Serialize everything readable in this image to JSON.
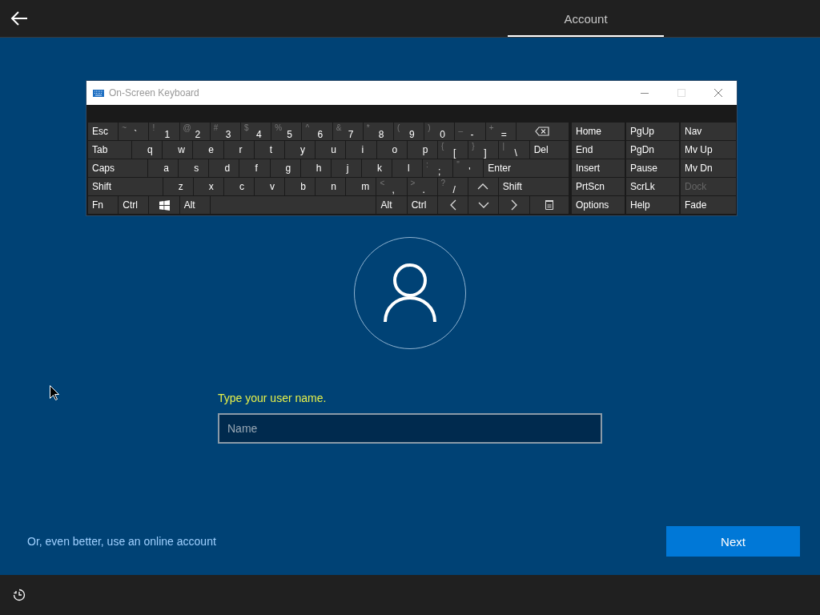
{
  "top_bar": {
    "tabs": [
      {
        "label": "Account",
        "selected": true
      }
    ]
  },
  "keyboard": {
    "title": "On-Screen Keyboard",
    "main_rows": [
      [
        {
          "kind": "key",
          "label": "Esc"
        },
        {
          "kind": "key",
          "shift": "~",
          "label": "`"
        },
        {
          "kind": "key",
          "shift": "!",
          "label": "1"
        },
        {
          "kind": "key",
          "shift": "@",
          "label": "2"
        },
        {
          "kind": "key",
          "shift": "#",
          "label": "3"
        },
        {
          "kind": "key",
          "shift": "$",
          "label": "4"
        },
        {
          "kind": "key",
          "shift": "%",
          "label": "5"
        },
        {
          "kind": "key",
          "shift": "^",
          "label": "6"
        },
        {
          "kind": "key",
          "shift": "&",
          "label": "7"
        },
        {
          "kind": "key",
          "shift": "*",
          "label": "8"
        },
        {
          "kind": "key",
          "shift": "(",
          "label": "9"
        },
        {
          "kind": "key",
          "shift": ")",
          "label": "0"
        },
        {
          "kind": "key",
          "shift": "_",
          "label": "-"
        },
        {
          "kind": "key",
          "shift": "+",
          "label": "="
        },
        {
          "kind": "backspace"
        }
      ],
      [
        {
          "kind": "key",
          "label": "Tab"
        },
        {
          "kind": "key",
          "label": "q"
        },
        {
          "kind": "key",
          "label": "w"
        },
        {
          "kind": "key",
          "label": "e"
        },
        {
          "kind": "key",
          "label": "r"
        },
        {
          "kind": "key",
          "label": "t"
        },
        {
          "kind": "key",
          "label": "y"
        },
        {
          "kind": "key",
          "label": "u"
        },
        {
          "kind": "key",
          "label": "i"
        },
        {
          "kind": "key",
          "label": "o"
        },
        {
          "kind": "key",
          "label": "p"
        },
        {
          "kind": "key",
          "shift": "{",
          "label": "["
        },
        {
          "kind": "key",
          "shift": "}",
          "label": "]"
        },
        {
          "kind": "key",
          "shift": "|",
          "label": "\\"
        },
        {
          "kind": "key",
          "label": "Del"
        }
      ],
      [
        {
          "kind": "key",
          "label": "Caps"
        },
        {
          "kind": "key",
          "label": "a"
        },
        {
          "kind": "key",
          "label": "s"
        },
        {
          "kind": "key",
          "label": "d"
        },
        {
          "kind": "key",
          "label": "f"
        },
        {
          "kind": "key",
          "label": "g"
        },
        {
          "kind": "key",
          "label": "h"
        },
        {
          "kind": "key",
          "label": "j"
        },
        {
          "kind": "key",
          "label": "k"
        },
        {
          "kind": "key",
          "label": "l"
        },
        {
          "kind": "key",
          "shift": ":",
          "label": ";"
        },
        {
          "kind": "key",
          "shift": "\"",
          "label": "'"
        },
        {
          "kind": "key",
          "label": "Enter"
        }
      ],
      [
        {
          "kind": "key",
          "label": "Shift"
        },
        {
          "kind": "key",
          "label": "z"
        },
        {
          "kind": "key",
          "label": "x"
        },
        {
          "kind": "key",
          "label": "c"
        },
        {
          "kind": "key",
          "label": "v"
        },
        {
          "kind": "key",
          "label": "b"
        },
        {
          "kind": "key",
          "label": "n"
        },
        {
          "kind": "key",
          "label": "m"
        },
        {
          "kind": "key",
          "shift": "<",
          "label": ","
        },
        {
          "kind": "key",
          "shift": ">",
          "label": "."
        },
        {
          "kind": "key",
          "shift": "?",
          "label": "/"
        },
        {
          "kind": "up"
        },
        {
          "kind": "key",
          "label": "Shift"
        }
      ],
      [
        {
          "kind": "key",
          "label": "Fn"
        },
        {
          "kind": "key",
          "label": "Ctrl"
        },
        {
          "kind": "windows"
        },
        {
          "kind": "key",
          "label": "Alt"
        },
        {
          "kind": "space"
        },
        {
          "kind": "key",
          "label": "Alt"
        },
        {
          "kind": "key",
          "label": "Ctrl"
        },
        {
          "kind": "left"
        },
        {
          "kind": "down"
        },
        {
          "kind": "right"
        },
        {
          "kind": "menu"
        }
      ]
    ],
    "side_rows": [
      [
        {
          "label": "Home",
          "disabled": false
        },
        {
          "label": "PgUp",
          "disabled": false
        },
        {
          "label": "Nav",
          "disabled": false
        }
      ],
      [
        {
          "label": "End",
          "disabled": false
        },
        {
          "label": "PgDn",
          "disabled": false
        },
        {
          "label": "Mv Up",
          "disabled": false
        }
      ],
      [
        {
          "label": "Insert",
          "disabled": false
        },
        {
          "label": "Pause",
          "disabled": false
        },
        {
          "label": "Mv Dn",
          "disabled": false
        }
      ],
      [
        {
          "label": "PrtScn",
          "disabled": false
        },
        {
          "label": "ScrLk",
          "disabled": false
        },
        {
          "label": "Dock",
          "disabled": true
        }
      ],
      [
        {
          "label": "Options",
          "disabled": false
        },
        {
          "label": "Help",
          "disabled": false
        },
        {
          "label": "Fade",
          "disabled": false
        }
      ]
    ]
  },
  "form": {
    "prompt": "Type your user name.",
    "name_field": {
      "placeholder": "Name"
    }
  },
  "online_account_link": "Or, even better, use an online account",
  "next_button": "Next"
}
